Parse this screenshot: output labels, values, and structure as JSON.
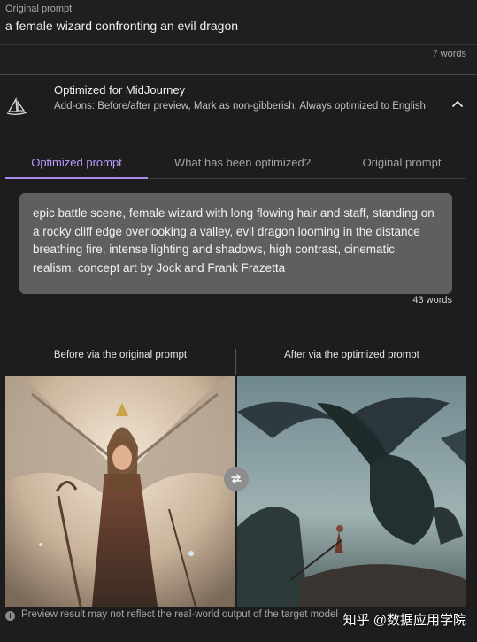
{
  "original": {
    "label": "Original prompt",
    "text": "a female wizard confronting an evil dragon",
    "word_count": "7 words"
  },
  "optimization": {
    "title": "Optimized for MidJourney",
    "addons": "Add-ons: Before/after preview, Mark as non-gibberish, Always optimized to English",
    "icon": "midjourney-sailboat-icon",
    "collapse_icon": "chevron-up-icon"
  },
  "tabs": [
    {
      "label": "Optimized prompt",
      "active": true
    },
    {
      "label": "What has been optimized?",
      "active": false
    },
    {
      "label": "Original prompt",
      "active": false
    }
  ],
  "optimized_prompt": {
    "text": "epic battle scene, female wizard with long flowing hair and staff, standing on a rocky cliff edge overlooking a valley, evil dragon looming in the distance breathing fire, intense lighting and shadows, high contrast, cinematic realism, concept art by Jock and Frank Frazetta",
    "word_count": "43 words"
  },
  "comparison": {
    "before_label": "Before via the original prompt",
    "after_label": "After via the optimized prompt",
    "swap_icon": "swap-arrows-icon"
  },
  "footer": {
    "note": "Preview result may not reflect the real-world output of the target model",
    "icon": "info-icon"
  },
  "watermark": "知乎 @数据应用学院",
  "colors": {
    "background": "#1d1d1d",
    "accent": "#b799ff",
    "prompt_box": "#5f5f5f"
  }
}
